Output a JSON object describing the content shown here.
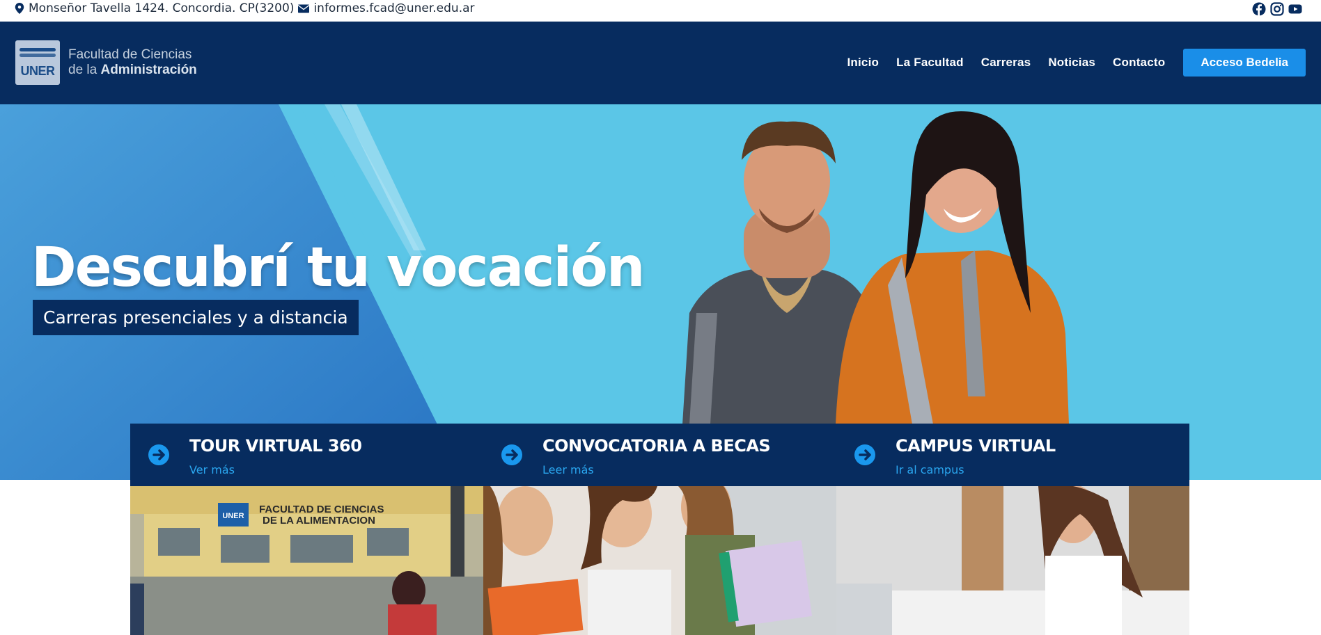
{
  "topbar": {
    "address": "Monseñor Tavella 1424. Concordia. CP(3200)",
    "email": "informes.fcad@uner.edu.ar",
    "social": [
      "facebook-icon",
      "instagram-icon",
      "youtube-icon"
    ]
  },
  "header": {
    "logo_mark": "UNER",
    "logo_line1": "Facultad de Ciencias",
    "logo_line2_prefix": "de la",
    "logo_line2_bold": "Administración",
    "nav": [
      "Inicio",
      "La Facultad",
      "Carreras",
      "Noticias",
      "Contacto"
    ],
    "cta": "Acceso Bedelia"
  },
  "hero": {
    "title": "Descubrí tu vocación",
    "tagline": "Carreras presenciales y a distancia"
  },
  "cards": [
    {
      "title": "TOUR VIRTUAL 360",
      "link": "Ver más"
    },
    {
      "title": "CONVOCATORIA A BECAS",
      "link": "Leer más"
    },
    {
      "title": "CAMPUS VIRTUAL",
      "link": "Ir al campus"
    }
  ],
  "photo_sign": {
    "badge": "UNER",
    "line1": "FACULTAD DE CIENCIAS",
    "line2": "DE LA ALIMENTACION"
  },
  "colors": {
    "navy": "#072c5f",
    "hero_sky": "#5bc6e7",
    "accent_blue": "#1a8ee8",
    "link_blue": "#2aa6ef"
  }
}
